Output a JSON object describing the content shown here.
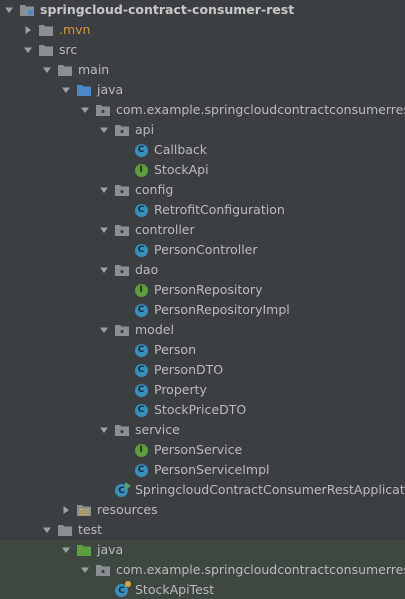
{
  "tree": [
    {
      "label": "springcloud-contract-consumer-rest",
      "depth": 0,
      "expanded": true,
      "icon": "module-folder-icon",
      "bold": true
    },
    {
      "label": ".mvn",
      "depth": 1,
      "expanded": false,
      "icon": "folder-icon",
      "excluded": true
    },
    {
      "label": "src",
      "depth": 1,
      "expanded": true,
      "icon": "folder-icon"
    },
    {
      "label": "main",
      "depth": 2,
      "expanded": true,
      "icon": "folder-icon"
    },
    {
      "label": "java",
      "depth": 3,
      "expanded": true,
      "icon": "source-root-icon"
    },
    {
      "label": "com.example.springcloudcontractconsumerrest",
      "depth": 4,
      "expanded": true,
      "icon": "package-icon"
    },
    {
      "label": "api",
      "depth": 5,
      "expanded": true,
      "icon": "package-icon"
    },
    {
      "label": "Callback",
      "depth": 6,
      "icon": "class-icon"
    },
    {
      "label": "StockApi",
      "depth": 6,
      "icon": "interface-icon"
    },
    {
      "label": "config",
      "depth": 5,
      "expanded": true,
      "icon": "package-icon"
    },
    {
      "label": "RetrofitConfiguration",
      "depth": 6,
      "icon": "class-icon"
    },
    {
      "label": "controller",
      "depth": 5,
      "expanded": true,
      "icon": "package-icon"
    },
    {
      "label": "PersonController",
      "depth": 6,
      "icon": "class-icon"
    },
    {
      "label": "dao",
      "depth": 5,
      "expanded": true,
      "icon": "package-icon"
    },
    {
      "label": "PersonRepository",
      "depth": 6,
      "icon": "interface-icon"
    },
    {
      "label": "PersonRepositoryImpl",
      "depth": 6,
      "icon": "class-icon"
    },
    {
      "label": "model",
      "depth": 5,
      "expanded": true,
      "icon": "package-icon"
    },
    {
      "label": "Person",
      "depth": 6,
      "icon": "class-icon"
    },
    {
      "label": "PersonDTO",
      "depth": 6,
      "icon": "class-icon"
    },
    {
      "label": "Property",
      "depth": 6,
      "icon": "class-icon"
    },
    {
      "label": "StockPriceDTO",
      "depth": 6,
      "icon": "class-icon"
    },
    {
      "label": "service",
      "depth": 5,
      "expanded": true,
      "icon": "package-icon"
    },
    {
      "label": "PersonService",
      "depth": 6,
      "icon": "interface-icon"
    },
    {
      "label": "PersonServiceImpl",
      "depth": 6,
      "icon": "class-icon"
    },
    {
      "label": "SpringcloudContractConsumerRestApplication",
      "depth": 5,
      "icon": "spring-boot-app-icon"
    },
    {
      "label": "resources",
      "depth": 3,
      "expanded": false,
      "icon": "resources-root-icon"
    },
    {
      "label": "test",
      "depth": 2,
      "expanded": true,
      "icon": "folder-icon"
    },
    {
      "label": "java",
      "depth": 3,
      "expanded": true,
      "icon": "test-source-root-icon",
      "test_scope": true
    },
    {
      "label": "com.example.springcloudcontractconsumerrest",
      "depth": 4,
      "expanded": true,
      "icon": "package-icon",
      "test_scope": true
    },
    {
      "label": "StockApiTest",
      "depth": 5,
      "icon": "test-class-icon",
      "test_scope": true
    }
  ]
}
